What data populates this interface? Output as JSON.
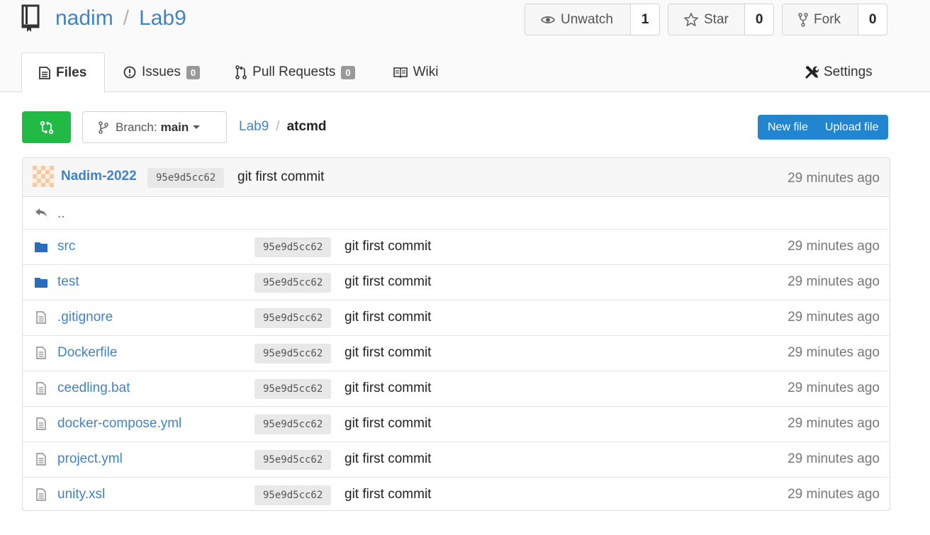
{
  "repo": {
    "owner": "nadim",
    "name": "Lab9"
  },
  "actions": [
    {
      "label": "Unwatch",
      "count": "1",
      "icon": "eye-icon"
    },
    {
      "label": "Star",
      "count": "0",
      "icon": "star-icon"
    },
    {
      "label": "Fork",
      "count": "0",
      "icon": "fork-icon"
    }
  ],
  "tabs": {
    "files": "Files",
    "issues": "Issues",
    "issues_count": "0",
    "pulls": "Pull Requests",
    "pulls_count": "0",
    "wiki": "Wiki",
    "settings": "Settings"
  },
  "toolbar": {
    "branch_prefix": "Branch:",
    "branch_name": "main",
    "breadcrumb_root": "Lab9",
    "breadcrumb_current": "atcmd",
    "new_file": "New file",
    "upload_file": "Upload file"
  },
  "latest_commit": {
    "author": "Nadim-2022",
    "sha": "95e9d5cc62",
    "message": "git first commit",
    "age": "29 minutes ago"
  },
  "parent_link": "..",
  "files": [
    {
      "name": "src",
      "type": "dir",
      "sha": "95e9d5cc62",
      "message": "git first commit",
      "age": "29 minutes ago"
    },
    {
      "name": "test",
      "type": "dir",
      "sha": "95e9d5cc62",
      "message": "git first commit",
      "age": "29 minutes ago"
    },
    {
      "name": ".gitignore",
      "type": "file",
      "sha": "95e9d5cc62",
      "message": "git first commit",
      "age": "29 minutes ago"
    },
    {
      "name": "Dockerfile",
      "type": "file",
      "sha": "95e9d5cc62",
      "message": "git first commit",
      "age": "29 minutes ago"
    },
    {
      "name": "ceedling.bat",
      "type": "file",
      "sha": "95e9d5cc62",
      "message": "git first commit",
      "age": "29 minutes ago"
    },
    {
      "name": "docker-compose.yml",
      "type": "file",
      "sha": "95e9d5cc62",
      "message": "git first commit",
      "age": "29 minutes ago"
    },
    {
      "name": "project.yml",
      "type": "file",
      "sha": "95e9d5cc62",
      "message": "git first commit",
      "age": "29 minutes ago"
    },
    {
      "name": "unity.xsl",
      "type": "file",
      "sha": "95e9d5cc62",
      "message": "git first commit",
      "age": "29 minutes ago"
    }
  ],
  "colors": {
    "link": "#4183c4",
    "green": "#21ba45",
    "blue": "#2185d0",
    "folder": "#2a6ebb"
  }
}
